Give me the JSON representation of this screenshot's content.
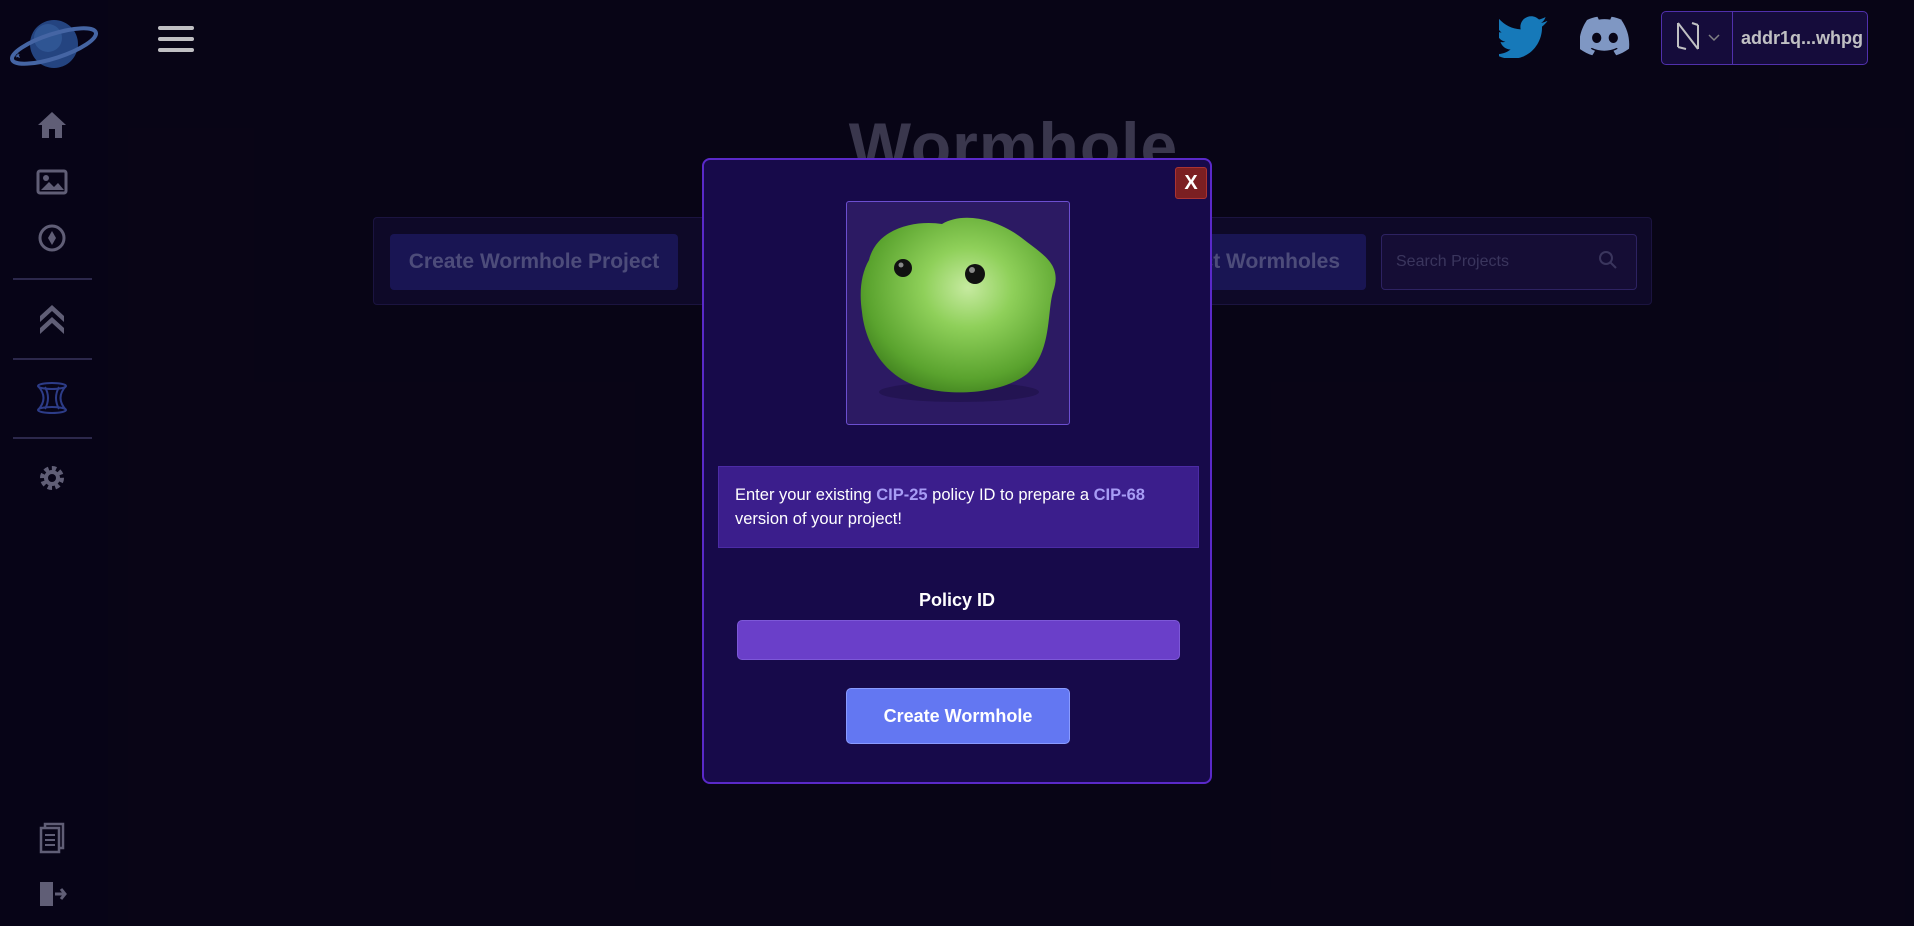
{
  "header": {
    "wallet_address": "addr1q...whpg"
  },
  "icons": {
    "logo": "planet-logo",
    "menu": "hamburger-menu-icon",
    "twitter": "twitter-icon",
    "discord": "discord-icon",
    "wallet_brand": "nami-wallet-icon",
    "sidebar": [
      "home-icon",
      "image-icon",
      "compass-icon",
      "chevrons-up-icon",
      "wormhole-icon",
      "gear-icon",
      "document-icon",
      "logout-icon"
    ]
  },
  "page": {
    "title": "Wormhole"
  },
  "toolbar": {
    "create_project_label": "Create Wormhole Project",
    "right_button_label": "ct Wormholes",
    "search_placeholder": "Search Projects"
  },
  "modal": {
    "close_label": "X",
    "info_prefix": "Enter your existing ",
    "info_cip25": "CIP-25",
    "info_middle": " policy ID to prepare a ",
    "info_cip68": "CIP-68",
    "info_suffix": " version of your project!",
    "policy_label": "Policy ID",
    "policy_value": "",
    "create_label": "Create Wormhole"
  },
  "colors": {
    "background": "#0a0619",
    "modal_bg": "#170a4a",
    "modal_border": "#5a29c9",
    "accent_button": "#6377f2",
    "close_button": "#7b1f22",
    "twitter_blue": "#1da1f2",
    "discord_blue": "#5865f2"
  }
}
